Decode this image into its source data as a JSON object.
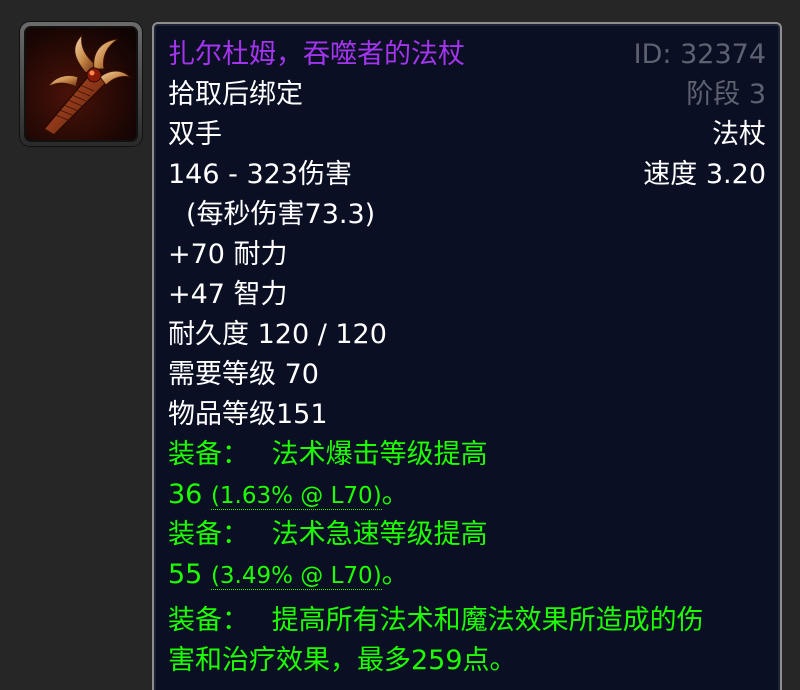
{
  "item": {
    "name": "扎尔杜姆，吞噬者的法杖",
    "id_label": "ID: 32374",
    "binding": "拾取后绑定",
    "phase": "阶段 3",
    "slot": "双手",
    "type": "法杖",
    "damage": "146 - 323伤害",
    "speed": "速度 3.20",
    "dps": "(每秒伤害73.3)",
    "stamina": "+70 耐力",
    "intellect": "+47 智力",
    "durability": "耐久度 120 / 120",
    "required_level": "需要等级 70",
    "item_level": "物品等级151",
    "equip1": {
      "prefix": "装备：",
      "text": "法术爆击等级提高",
      "value": "36",
      "detail": "(1.63% @ L70)",
      "suffix": "。"
    },
    "equip2": {
      "prefix": "装备：",
      "text": "法术急速等级提高",
      "value": "55",
      "detail": "(3.49% @ L70)",
      "suffix": "。"
    },
    "equip3": {
      "prefix": "装备：",
      "line1": "提高所有法术和魔法效果所造成的伤",
      "line2": "害和治疗效果，最多259点。"
    }
  },
  "colors": {
    "epic": "#a335ee",
    "equip": "#1eff00",
    "meta": "#5d6270",
    "background": "#0a0f24"
  },
  "icon": "staff-claw-icon"
}
